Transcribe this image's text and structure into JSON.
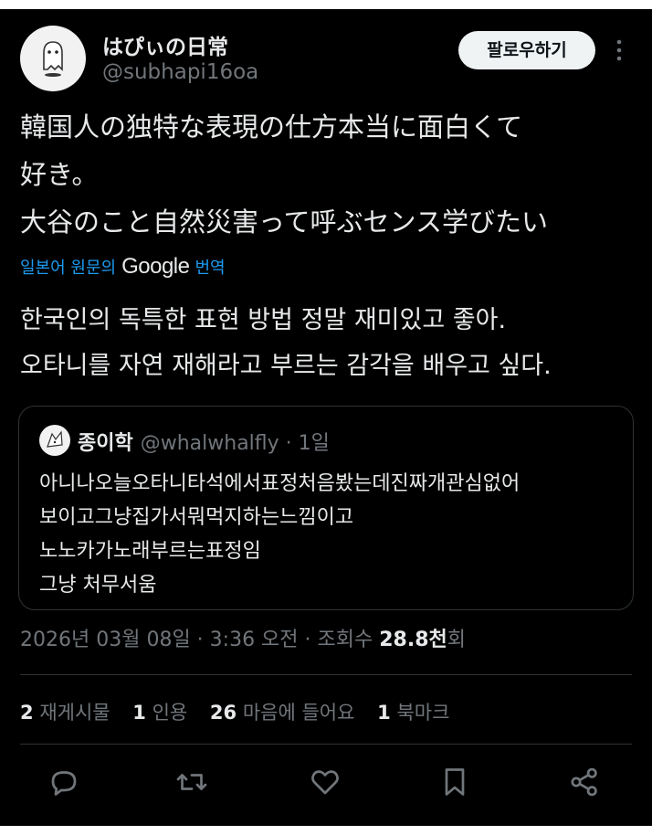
{
  "author": {
    "name": "はぴぃの日常",
    "handle": "@subhapi16oa",
    "avatar_icon": "ghost-avatar-icon"
  },
  "follow_label": "팔로우하기",
  "tweet": {
    "lines": [
      "韓国人の独特な表現の仕方本当に面白くて",
      "好き。",
      "大谷のこと自然災害って呼ぶセンス学びたい"
    ]
  },
  "translation": {
    "prefix": "일본어 원문의",
    "brand": "Google",
    "suffix": "번역",
    "lines": [
      "한국인의 독특한 표현 방법 정말 재미있고 좋아.",
      "오타니를 자연 재해라고 부르는 감각을 배우고 싶다."
    ]
  },
  "quote": {
    "name": "종이학",
    "handle": "@whalwhalfly · 1일",
    "lines": [
      "아니나오늘오타니타석에서표정처음봤는데진짜개관심없어",
      "보이고그냥집가서뭐먹지하는느낌이고",
      "노노카가노래부르는표정임",
      "그냥 처무서움"
    ]
  },
  "meta": {
    "datetime": "2026년 03월 08일 · 3:36 오전 · 조회수 ",
    "views": "28.8천",
    "views_suffix": "회"
  },
  "stats": {
    "reposts_num": "2",
    "reposts_label": "재게시물",
    "quotes_num": "1",
    "quotes_label": "인용",
    "likes_num": "26",
    "likes_label": "마음에 들어요",
    "bookmarks_num": "1",
    "bookmarks_label": "북마크"
  },
  "actions": [
    "reply-icon",
    "retweet-icon",
    "like-icon",
    "bookmark-icon",
    "share-icon"
  ],
  "colors": {
    "background": "#000000",
    "text": "#e7e9ea",
    "muted": "#71767b",
    "link": "#1d9bf0",
    "button": "#eff3f4"
  }
}
